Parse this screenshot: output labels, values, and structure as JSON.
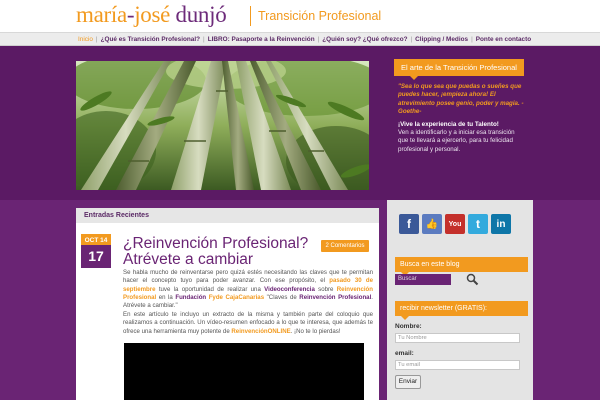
{
  "header": {
    "logo_part1": "maría",
    "logo_dash1": "-",
    "logo_part2": "josé",
    "logo_part3": "dunjó",
    "tagline": "Transición Profesional"
  },
  "nav": {
    "items": [
      {
        "label": "Inicio",
        "active": true
      },
      {
        "label": "¿Qué es Transición Profesional?"
      },
      {
        "label": "LIBRO: Pasaporte a la Reinvención"
      },
      {
        "label": "¿Quién soy? ¿Qué ofrezco?"
      },
      {
        "label": "Clipping / Medios"
      },
      {
        "label": "Ponte en contacto"
      }
    ],
    "separator": "|"
  },
  "side_box": {
    "title": "El arte de la Transición Profesional",
    "quote": "\"Sea lo que sea que puedas o sueñes que puedes hacer, ¡empieza ahora! El atrevimiento posee genio, poder y magia. -Goethe-",
    "talent_title": "¡Vive la experiencia de tu Talento!",
    "talent_text": "Ven a identificarlo y a iniciar esa transición que te llevará a ejercerlo, para tu felicidad profesional y personal."
  },
  "main": {
    "entries_title": "Entradas Recientes",
    "post": {
      "month": "OCT 14",
      "day": "17",
      "title": "¿Reinvención Profesional? Atrévete a cambiar",
      "comments": "2 Comentarios",
      "para1_a": "Se habla mucho de reinventarse pero quizá estés necesitando las claves que te permitan hacer el concepto tuyo para poder avanzar. Con ese propósito, el ",
      "para1_b": "pasado 30 de septiembre",
      "para1_c": " tuve la oportunidad de realizar una ",
      "para1_d": "Videoconferencia",
      "para1_e": " sobre ",
      "para1_f": "Reinvención Profesional",
      "para1_g": " en la ",
      "para1_h": "Fundación",
      "para1_i": " ",
      "para1_j": "Fyde CajaCanarias",
      "para1_k": " \"Claves de ",
      "para1_l": "Reinvención Profesional",
      "para1_m": ". Atrévete a cambiar.\"",
      "para2_a": "En este artículo te incluyo un extracto de la misma y también parte del coloquio que realizamos a continuación. Un vídeo-resumen enfocado a lo que te interesa, que además te ofrece una herramienta muy potente de ",
      "para2_b": "ReinvenciónONLINE",
      "para2_c": ". ¡No te lo pierdas!"
    }
  },
  "sidebar": {
    "social": [
      {
        "name": "facebook",
        "glyph": "f",
        "color": "#3b5998"
      },
      {
        "name": "like",
        "glyph": "👍",
        "color": "#5b7bc0"
      },
      {
        "name": "youtube",
        "glyph": "You",
        "color": "#c4302b"
      },
      {
        "name": "twitter",
        "glyph": "t",
        "color": "#33aadd"
      },
      {
        "name": "linkedin",
        "glyph": "in",
        "color": "#0e76a8"
      }
    ],
    "search_title": "Busca en este blog",
    "search_placeholder": "Buscar",
    "newsletter_title": "recibir newsletter (GRATIS):",
    "name_label": "Nombre:",
    "name_placeholder": "Tu Nombre",
    "email_label": "email:",
    "email_placeholder": "Tu email",
    "send_label": "Enviar"
  },
  "colors": {
    "accent": "#f29a1f",
    "brand_purple": "#6a2474",
    "background": "#5b1a64"
  }
}
